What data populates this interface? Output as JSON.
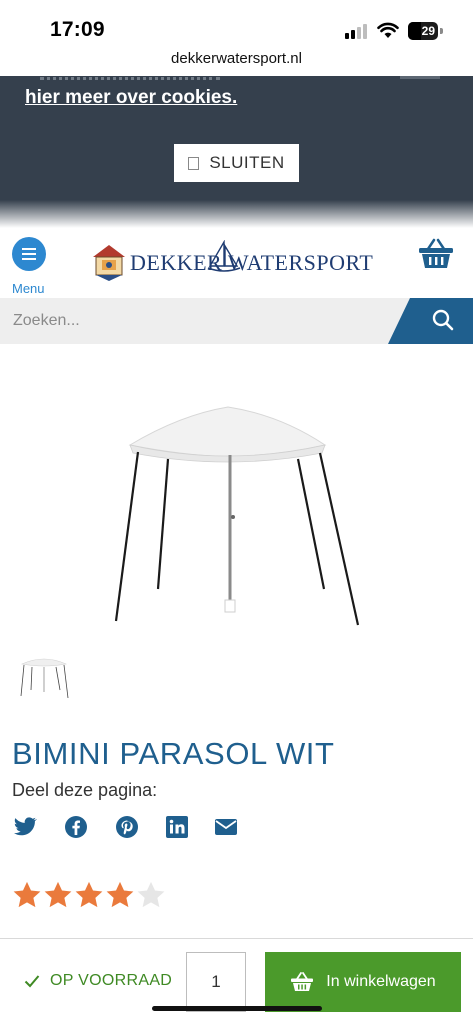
{
  "status_bar": {
    "time": "17:09",
    "battery": "29",
    "url": "dekkerwatersport.nl"
  },
  "cookie_banner": {
    "link_text": "hier meer over cookies.",
    "close_label": "SLUITEN"
  },
  "header": {
    "menu_label": "Menu",
    "logo_text": "DEKKER WATERSPORT"
  },
  "search": {
    "placeholder": "Zoeken..."
  },
  "product": {
    "title": "BIMINI PARASOL WIT",
    "share_label": "Deel deze pagina:",
    "share_icons": [
      "twitter-icon",
      "facebook-icon",
      "pinterest-icon",
      "linkedin-icon",
      "mail-icon"
    ],
    "rating": 4,
    "rating_max": 5
  },
  "purchase_bar": {
    "stock_text": "OP VOORRAAD",
    "quantity": "1",
    "cart_label": "In winkelwagen"
  },
  "colors": {
    "brand_blue": "#1f5f8e",
    "menu_blue": "#2d88d0",
    "banner_bg": "#35404d",
    "green": "#4b9a2b",
    "star_orange": "#ea7a3c"
  }
}
